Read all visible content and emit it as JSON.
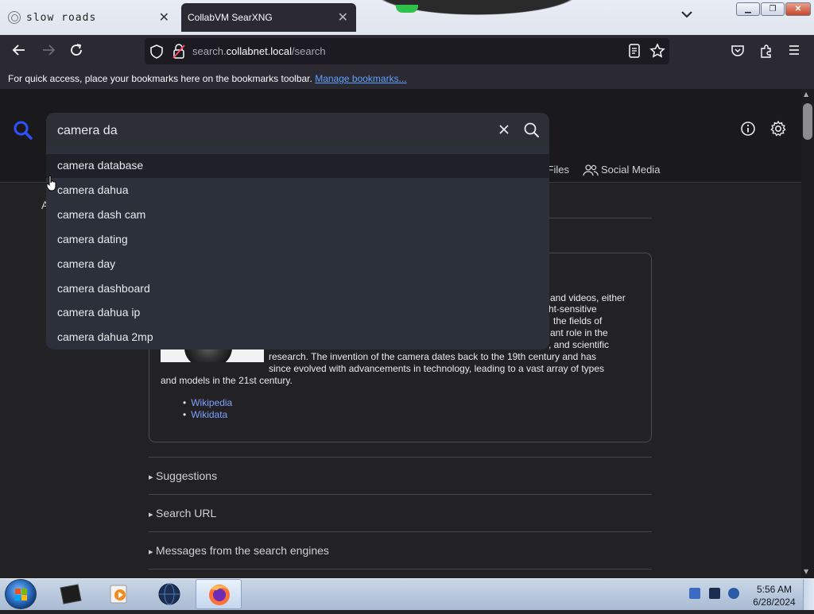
{
  "browser": {
    "tabs": [
      {
        "title": "slow roads"
      },
      {
        "title": "CollabVM SearXNG"
      }
    ],
    "url_prefix": "search.",
    "url_host": "collabnet.local",
    "url_path": "/search",
    "bookmarks_message": "For quick access, place your bookmarks here on the bookmarks toolbar.",
    "manage_bookmarks": "Manage bookmarks..."
  },
  "search": {
    "query": "camera da",
    "suggestions": [
      "camera database",
      "camera dahua",
      "camera dash cam",
      "camera dating",
      "camera day",
      "camera dashboard",
      "camera dahua ip",
      "camera dahua 2mp"
    ],
    "categories": {
      "files_partial": "Files",
      "social_media": "Social Media"
    },
    "left_partial": "A"
  },
  "infobox": {
    "text_lines_right": [
      "and videos, either",
      "ht-sensitive",
      "the fields of",
      "ant role in the",
      ", and scientific"
    ],
    "line_research": "research. The invention of the camera dates back to the 19th century and has",
    "line_since": "since evolved with advancements in technology, leading to a vast array of types",
    "line_models": "and models in the 21st century.",
    "links": [
      "Wikipedia",
      "Wikidata"
    ]
  },
  "sections": [
    "Suggestions",
    "Search URL",
    "Messages from the search engines"
  ],
  "taskbar": {
    "time": "5:56 AM",
    "date": "6/28/2024"
  },
  "colors": {
    "accent_blue": "#5ea1ff",
    "search_logo": "#3050ff",
    "page_bg": "#222225"
  }
}
